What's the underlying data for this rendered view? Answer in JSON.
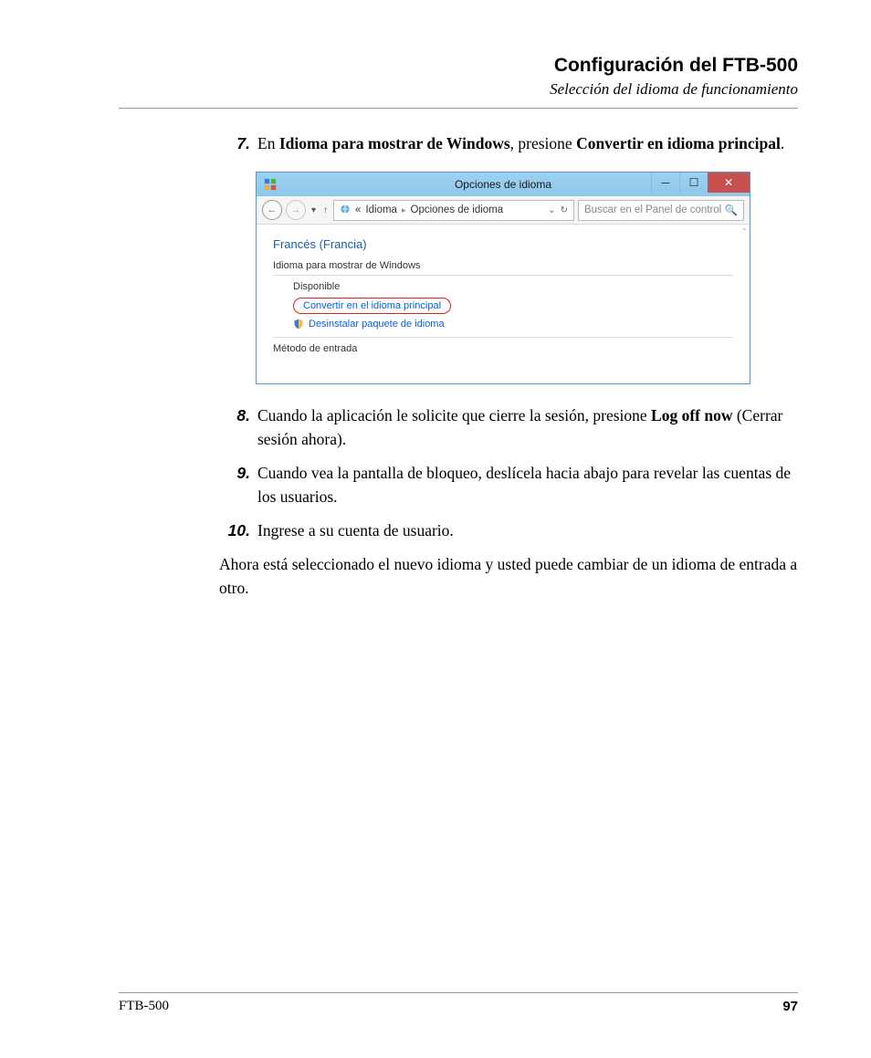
{
  "header": {
    "title": "Configuración del FTB-500",
    "subtitle": "Selección del idioma de funcionamiento"
  },
  "steps": {
    "s7": {
      "num": "7.",
      "pre": "En ",
      "bold1": "Idioma para mostrar de Windows",
      "mid": ", presione ",
      "bold2": "Convertir en idioma principal",
      "post": "."
    },
    "s8": {
      "num": "8.",
      "pre": "Cuando la aplicación le solicite que cierre la sesión, presione ",
      "bold1": "Log off now",
      "post": " (Cerrar sesión ahora)."
    },
    "s9": {
      "num": "9.",
      "text": "Cuando vea la pantalla de bloqueo, deslícela hacia abajo para revelar las cuentas de los usuarios."
    },
    "s10": {
      "num": "10.",
      "text": "Ingrese a su cuenta de usuario."
    }
  },
  "after": "Ahora está seleccionado el nuevo idioma y usted puede cambiar de un idioma de entrada a otro.",
  "win": {
    "title": "Opciones de idioma",
    "breadcrumb": {
      "a": "«",
      "b": "Idioma",
      "c": "Opciones de idioma"
    },
    "search_placeholder": "Buscar en el Panel de control",
    "lang": "Francés (Francia)",
    "group": "Idioma para mostrar de Windows",
    "available": "Disponible",
    "make_primary": "Convertir en el idioma principal",
    "uninstall": "Desinstalar paquete de idioma",
    "method": "Método de entrada"
  },
  "footer": {
    "left": "FTB-500",
    "right": "97"
  }
}
